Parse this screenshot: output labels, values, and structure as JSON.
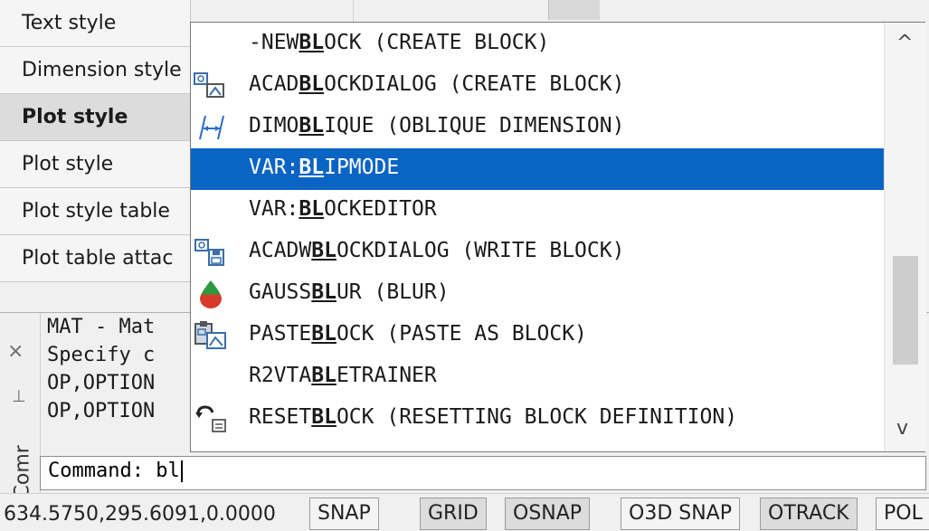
{
  "properties": {
    "rows": [
      {
        "label": "Text style"
      },
      {
        "label": "Dimension style"
      },
      {
        "label": "Plot style"
      },
      {
        "label": "Plot style"
      },
      {
        "label": "Plot style table"
      },
      {
        "label": "Plot table attac"
      }
    ]
  },
  "command_window": {
    "title": "Comr",
    "history": [
      "MAT - Mat",
      "Specify c",
      "OP,OPTION",
      "OP,OPTION"
    ],
    "prompt": "Command:",
    "input_value": "bl"
  },
  "autocomplete": {
    "selected_index": 3,
    "items": [
      {
        "pre": "-NEW",
        "hl": "BL",
        "post": "OCK (CREATE BLOCK)",
        "icon": "none"
      },
      {
        "pre": "ACAD",
        "hl": "BL",
        "post": "OCKDIALOG (CREATE BLOCK)",
        "icon": "create-block-icon"
      },
      {
        "pre": "DIMO",
        "hl": "BL",
        "post": "IQUE (OBLIQUE DIMENSION)",
        "icon": "oblique-dimension-icon"
      },
      {
        "pre": "VAR:",
        "hl": "BL",
        "post": "IPMODE",
        "icon": "none"
      },
      {
        "pre": "VAR:",
        "hl": "BL",
        "post": "OCKEDITOR",
        "icon": "none"
      },
      {
        "pre": "ACADW",
        "hl": "BL",
        "post": "OCKDIALOG (WRITE BLOCK)",
        "icon": "write-block-icon"
      },
      {
        "pre": "GAUSS",
        "hl": "BL",
        "post": "UR (BLUR)",
        "icon": "blur-drop-icon"
      },
      {
        "pre": "PASTE",
        "hl": "BL",
        "post": "OCK (PASTE AS BLOCK)",
        "icon": "paste-block-icon"
      },
      {
        "pre": "R2VTA",
        "hl": "BL",
        "post": "ETRAINER",
        "icon": "none"
      },
      {
        "pre": "RESET",
        "hl": "BL",
        "post": "OCK (RESETTING BLOCK DEFINITION)",
        "icon": "reset-block-icon"
      }
    ],
    "scroll_up_glyph": "^",
    "scroll_down_glyph": "v"
  },
  "statusbar": {
    "coords": "634.5750,295.6091,0.0000",
    "buttons": [
      {
        "label": "SNAP",
        "on": false
      },
      {
        "label": "GRID",
        "on": true
      },
      {
        "label": "OSNAP",
        "on": true
      },
      {
        "label": "O3D SNAP",
        "on": false
      },
      {
        "label": "OTRACK",
        "on": true
      },
      {
        "label": "POL",
        "on": false
      }
    ]
  },
  "colors": {
    "selection": "#0a64c4",
    "drop_green": "#2e9a3e",
    "drop_red": "#d83a2a"
  }
}
